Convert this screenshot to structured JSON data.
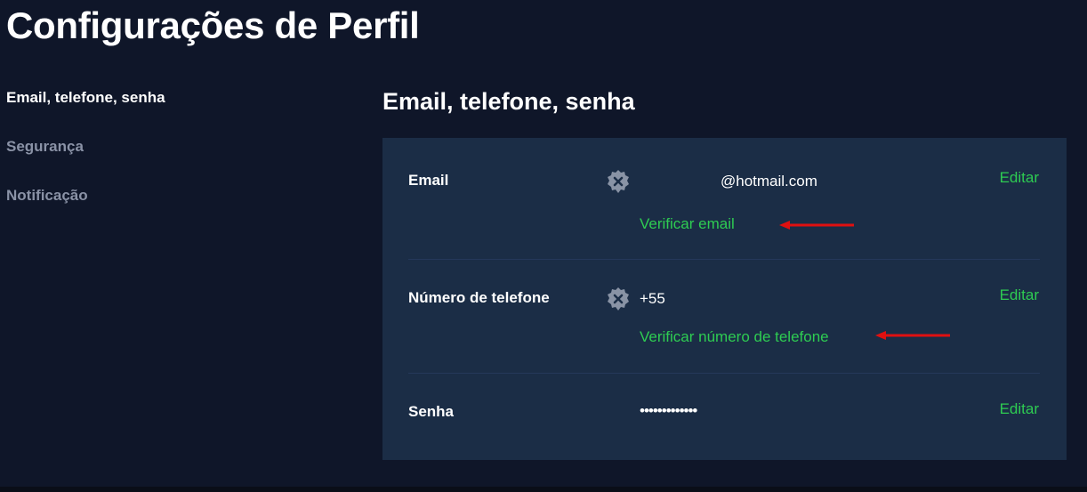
{
  "page": {
    "title": "Configurações de Perfil"
  },
  "sidebar": {
    "items": [
      {
        "label": "Email, telefone, senha",
        "active": true
      },
      {
        "label": "Segurança",
        "active": false
      },
      {
        "label": "Notificação",
        "active": false
      }
    ]
  },
  "section": {
    "title": "Email, telefone, senha"
  },
  "rows": {
    "email": {
      "label": "Email",
      "status_icon": "unverified-x-badge-icon",
      "value": "@hotmail.com",
      "verify_label": "Verificar email",
      "edit_label": "Editar"
    },
    "phone": {
      "label": "Número de telefone",
      "status_icon": "unverified-x-badge-icon",
      "value": "+55",
      "verify_label": "Verificar número de telefone",
      "edit_label": "Editar"
    },
    "password": {
      "label": "Senha",
      "value": "•••••••••••••",
      "edit_label": "Editar"
    }
  },
  "colors": {
    "background": "#0f1629",
    "card": "#1b2d46",
    "accent_green": "#2ecc52",
    "muted_text": "#8a92a6",
    "annotation_arrow": "#e01010"
  }
}
